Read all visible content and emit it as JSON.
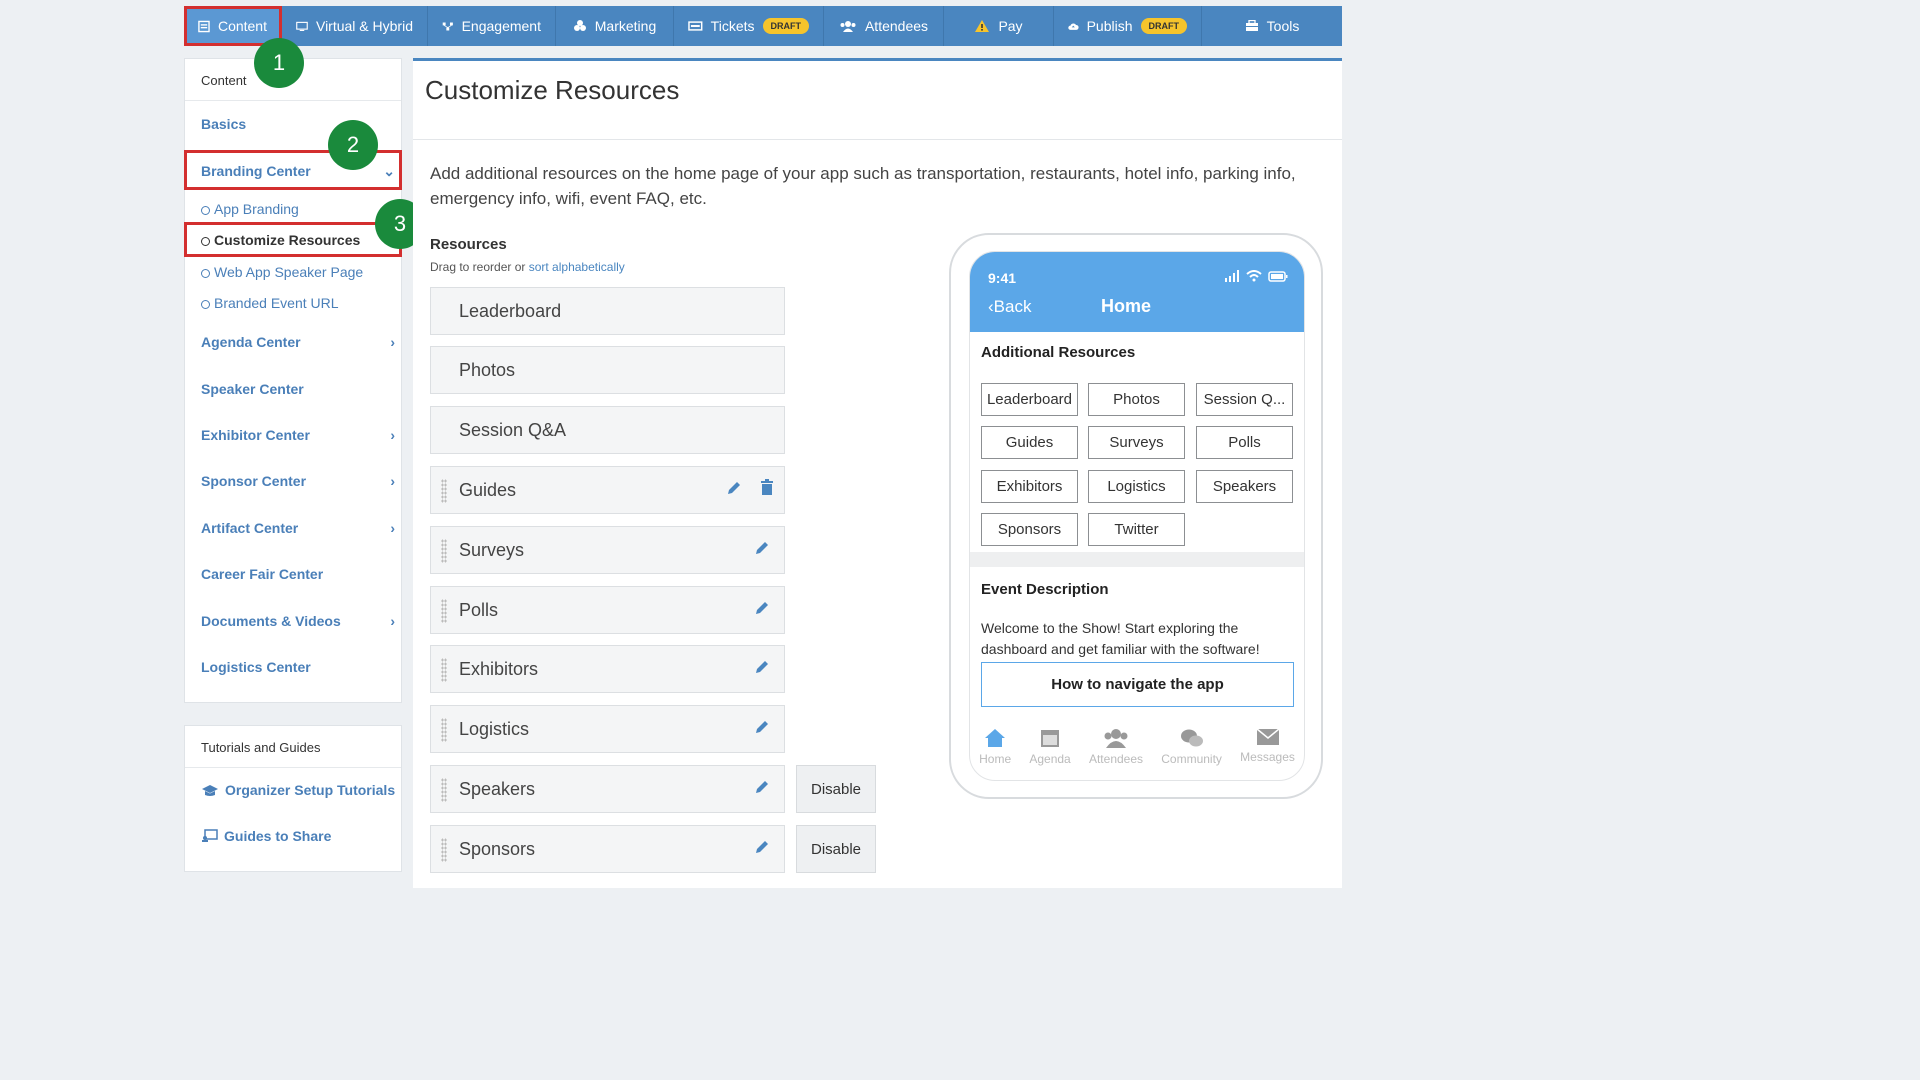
{
  "topnav": {
    "tabs": [
      {
        "label": "Content",
        "icon": "content-icon"
      },
      {
        "label": "Virtual & Hybrid",
        "icon": "monitor-icon"
      },
      {
        "label": "Engagement",
        "icon": "engagement-icon"
      },
      {
        "label": "Marketing",
        "icon": "marketing-icon"
      },
      {
        "label": "Tickets",
        "icon": "ticket-icon",
        "badge": "DRAFT"
      },
      {
        "label": "Attendees",
        "icon": "attendees-icon"
      },
      {
        "label": "Pay",
        "icon": "warning-icon"
      },
      {
        "label": "Publish",
        "icon": "cloud-upload-icon",
        "badge": "DRAFT"
      },
      {
        "label": "Tools",
        "icon": "toolbox-icon"
      }
    ]
  },
  "sidebar": {
    "header": "Content",
    "basics": "Basics",
    "branding": "Branding Center",
    "branding_sub": [
      "App Branding",
      "Customize Resources",
      "Web App Speaker Page",
      "Branded Event URL"
    ],
    "items": [
      "Agenda Center",
      "Speaker Center",
      "Exhibitor Center",
      "Sponsor Center",
      "Artifact Center",
      "Career Fair Center",
      "Documents & Videos",
      "Logistics Center"
    ],
    "tutorials": {
      "header": "Tutorials and Guides",
      "links": [
        "Organizer Setup Tutorials",
        "Guides to Share"
      ]
    }
  },
  "badges": [
    "1",
    "2",
    "3"
  ],
  "main": {
    "title": "Customize Resources",
    "description": "Add additional resources on the home page of your app such as transportation, restaurants, hotel info, parking info, emergency info, wifi, event FAQ, etc.",
    "resources_title": "Resources",
    "hint_prefix": "Drag to reorder or ",
    "hint_link": "sort alphabetically",
    "resources": [
      "Leaderboard",
      "Photos",
      "Session Q&A",
      "Guides",
      "Surveys",
      "Polls",
      "Exhibitors",
      "Logistics",
      "Speakers",
      "Sponsors"
    ],
    "disable_label": "Disable"
  },
  "phone": {
    "time": "9:41",
    "back": "Back",
    "title": "Home",
    "resources_heading": "Additional Resources",
    "buttons": [
      "Leaderboard",
      "Photos",
      "Session Q...",
      "Guides",
      "Surveys",
      "Polls",
      "Exhibitors",
      "Logistics",
      "Speakers",
      "Sponsors",
      "Twitter"
    ],
    "event_heading": "Event Description",
    "event_text": "Welcome to the Show! Start exploring the dashboard and get familiar with the software!",
    "nav_button": "How to navigate the app",
    "bottom_nav": [
      "Home",
      "Agenda",
      "Attendees",
      "Community",
      "Messages"
    ]
  },
  "colors": {
    "nav": "#4a86c0",
    "accent": "#5ba7e8",
    "highlight": "#d32f2f",
    "badge": "#1a8a3c",
    "draft": "#f6c42c"
  }
}
